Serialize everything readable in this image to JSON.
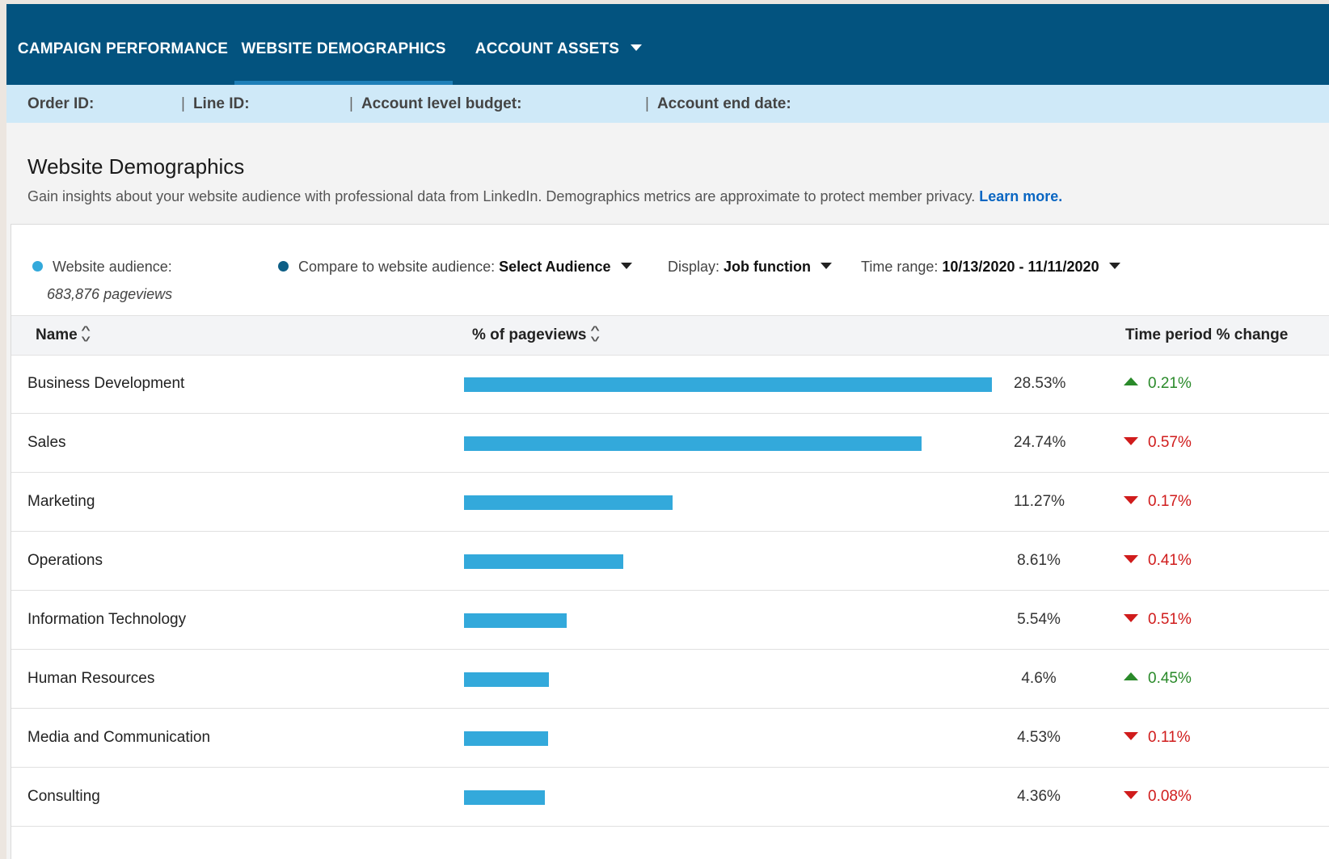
{
  "nav": {
    "tabs": [
      {
        "label": "CAMPAIGN PERFORMANCE",
        "active": false
      },
      {
        "label": "WEBSITE DEMOGRAPHICS",
        "active": true
      },
      {
        "label": "ACCOUNT ASSETS",
        "active": false,
        "has_dropdown": true
      }
    ]
  },
  "info_bar": {
    "order_id": "Order ID:",
    "line_id": "Line ID:",
    "budget": "Account level budget:",
    "end_date": "Account end date:",
    "separator": "|"
  },
  "page": {
    "title": "Website Demographics",
    "description": "Gain insights about your website audience with professional data from LinkedIn. Demographics metrics are approximate to protect member privacy.",
    "learn_more": "Learn more."
  },
  "filters": {
    "audience_label": "Website audience:",
    "audience_pageviews": "683,876 pageviews",
    "compare_label": "Compare to website audience:",
    "compare_value": "Select Audience",
    "display_label": "Display:",
    "display_value": "Job function",
    "time_label": "Time range:",
    "time_value": "10/13/2020 - 11/11/2020"
  },
  "table": {
    "headers": {
      "name": "Name",
      "pageviews": "% of pageviews",
      "change": "Time period % change"
    },
    "rows": [
      {
        "name": "Business Development",
        "value": 28.53,
        "pct": "28.53%",
        "direction": "up",
        "change": "0.21%"
      },
      {
        "name": "Sales",
        "value": 24.74,
        "pct": "24.74%",
        "direction": "down",
        "change": "0.57%"
      },
      {
        "name": "Marketing",
        "value": 11.27,
        "pct": "11.27%",
        "direction": "down",
        "change": "0.17%"
      },
      {
        "name": "Operations",
        "value": 8.61,
        "pct": "8.61%",
        "direction": "down",
        "change": "0.41%"
      },
      {
        "name": "Information Technology",
        "value": 5.54,
        "pct": "5.54%",
        "direction": "down",
        "change": "0.51%"
      },
      {
        "name": "Human Resources",
        "value": 4.6,
        "pct": "4.6%",
        "direction": "up",
        "change": "0.45%"
      },
      {
        "name": "Media and Communication",
        "value": 4.53,
        "pct": "4.53%",
        "direction": "down",
        "change": "0.11%"
      },
      {
        "name": "Consulting",
        "value": 4.36,
        "pct": "4.36%",
        "direction": "down",
        "change": "0.08%"
      }
    ]
  },
  "colors": {
    "nav_bg": "#03537f",
    "info_bg": "#cfe9f8",
    "bar": "#33a9db",
    "audience_dot": "#33a9db",
    "compare_dot": "#0e5f86",
    "up": "#2a8a2a",
    "down": "#d01c1c",
    "link": "#0a66c2"
  },
  "icons": {
    "dropdown": "caret-down-icon",
    "sort": "sort-icon",
    "trend_up": "triangle-up-icon",
    "trend_down": "triangle-down-icon"
  }
}
